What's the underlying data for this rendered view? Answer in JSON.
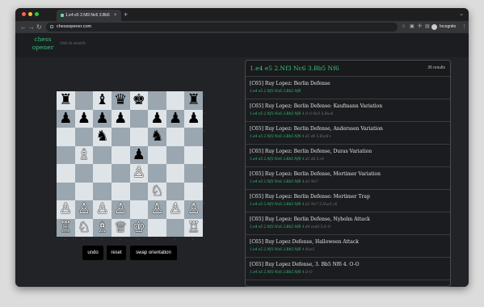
{
  "browser": {
    "tab_title": "1.e4 e5 2.Nf3 Nc6 3.Bb5 Nf6",
    "tab_close": "×",
    "new_tab": "+",
    "tabbar_right_icon": "chevron-down-icon",
    "url": "chessopener.com",
    "profile_label": "Incognito",
    "window_controls": {
      "close": "#ff5f57",
      "minimize": "#febc2e",
      "maximize": "#28c840"
    }
  },
  "site": {
    "logo_line1": "chess",
    "logo_line2": "opener",
    "search_placeholder": "click to search",
    "accent": "#35c27a"
  },
  "board": {
    "ranks": [
      "8",
      "7",
      "6",
      "5",
      "4",
      "3",
      "2",
      "1"
    ],
    "files": [
      "a",
      "b",
      "c",
      "d",
      "e",
      "f",
      "g",
      "h"
    ],
    "pieces": [
      "♜",
      "",
      "♝",
      "♛",
      "♚",
      "",
      "",
      "♜",
      "♟",
      "♟",
      "♟",
      "♟",
      "",
      "♟",
      "♟",
      "♟",
      "",
      "",
      "♞",
      "",
      "",
      "♞",
      "",
      "",
      "",
      "♗",
      "",
      "",
      "♟",
      "",
      "",
      "",
      "",
      "",
      "",
      "",
      "♙",
      "",
      "",
      "",
      "",
      "",
      "",
      "",
      "",
      "♘",
      "",
      "",
      "♙",
      "♙",
      "♙",
      "♙",
      "",
      "♙",
      "♙",
      "♙",
      "♖",
      "♘",
      "♗",
      "♕",
      "♔",
      "",
      "",
      "♖"
    ]
  },
  "controls": {
    "undo": "undo",
    "reset": "reset",
    "swap": "swap orientation"
  },
  "results": {
    "moves": "1.e4 e5 2.Nf3 Nc6 3.Bb5 Nf6",
    "count": "36 results",
    "items": [
      {
        "name": "[C65] Ruy Lopez: Berlin Defense",
        "base": "1.e4 e5 2.Nf3 Nc6 3.Bb5 Nf6",
        "ext": ""
      },
      {
        "name": "[C65] Ruy Lopez: Berlin Defense: Kaufmann Variation",
        "base": "1.e4 e5 2.Nf3 Nc6 3.Bb5 Nf6",
        "ext": " 4.O-O Bc5 5.Bxc6"
      },
      {
        "name": "[C65] Ruy Lopez: Berlin Defense, Anderssen Variation",
        "base": "1.e4 e5 2.Nf3 Nc6 3.Bb5 Nf6",
        "ext": " 4.d3 d6 5.Bxc6+"
      },
      {
        "name": "[C65] Ruy Lopez: Berlin Defense, Duras Variation",
        "base": "1.e4 e5 2.Nf3 Nc6 3.Bb5 Nf6",
        "ext": " 4.d3 d6 5.c4"
      },
      {
        "name": "[C65] Ruy Lopez: Berlin Defense, Mortimer Variation",
        "base": "1.e4 e5 2.Nf3 Nc6 3.Bb5 Nf6",
        "ext": " 4.d3 Ne7"
      },
      {
        "name": "[C65] Ruy Lopez: Berlin Defense: Mortimer Trap",
        "base": "1.e4 e5 2.Nf3 Nc6 3.Bb5 Nf6",
        "ext": " 4.d3 Ne7 5.Nxe5 c6"
      },
      {
        "name": "[C65] Ruy Lopez: Berlin Defense, Nyholm Attack",
        "base": "1.e4 e5 2.Nf3 Nc6 3.Bb5 Nf6",
        "ext": " 4.d4 exd4 5.O-O"
      },
      {
        "name": "[C65] Ruy Lopez Defense, Halloween Attack",
        "base": "1.e4 e5 2.Nf3 Nc6 3.Bb5 Nf6",
        "ext": " 4.Nxe5"
      },
      {
        "name": "[C65] Ruy Lopez Defense, 3. Bb5 Nf6 4. O-O",
        "base": "1.e4 e5 2.Nf3 Nc6 3.Bb5 Nf6",
        "ext": " 4.O-O"
      }
    ]
  }
}
